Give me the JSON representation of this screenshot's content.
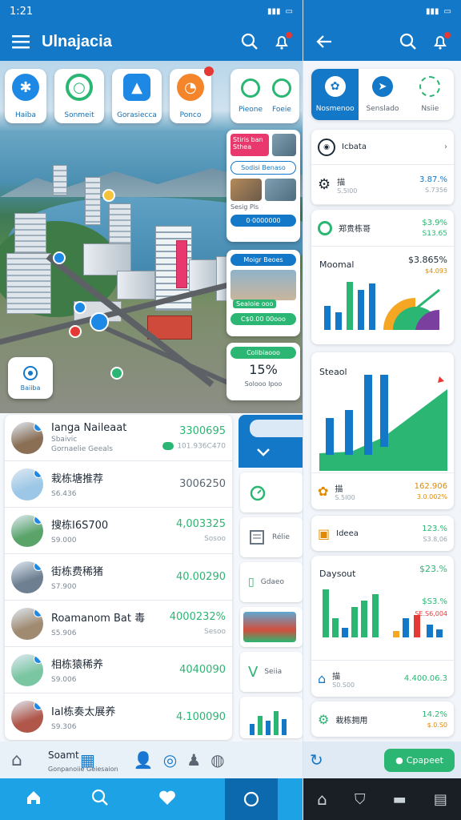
{
  "left": {
    "status": {
      "time": "1:21"
    },
    "header": {
      "title": "Ulnajacia"
    },
    "categories": [
      {
        "label": "Haiba",
        "icon": "asterisk-icon",
        "color": "#1e88e5"
      },
      {
        "label": "Sonmeit",
        "icon": "ring-icon",
        "color": "#2bb673"
      },
      {
        "label": "Gorasiecca",
        "icon": "cap-icon",
        "color": "#1e88e5"
      },
      {
        "label": "Ponco",
        "icon": "tag-icon",
        "color": "#f5852a"
      }
    ],
    "categories_right": [
      {
        "label": "Pieone"
      },
      {
        "label": "Foeie"
      }
    ],
    "side_cards": {
      "card1": {
        "pink_text": "Stiris ban Sthea",
        "pill": "Sodisi Benaso",
        "caption": "Sesig Pls",
        "button": "0·0000000"
      },
      "card2": {
        "pill": "Moigr Beoes",
        "tag": "Sealoie ooo",
        "button": "C$0.00 00ooo"
      },
      "card3": {
        "pill": "Colibiaooo",
        "percent": "15%",
        "caption": "Solooo Ipoo"
      }
    },
    "location_button": {
      "label": "Baiiba"
    },
    "list": [
      {
        "title": "Ianga Naileaat",
        "sub": "Sbaivic",
        "sub2": "Gornaelie Geeals",
        "value": "3300695",
        "value2": "101.936C470",
        "value_color": "#2bb673",
        "avatar": "#8a6f55"
      },
      {
        "title": "栽栋塘推荐",
        "sub": "S6.436",
        "value": "3006250",
        "value2": "",
        "value_color": "#5b6673",
        "avatar": "#9cc7e6"
      },
      {
        "title": "搜栋I6S700",
        "sub": "S9.000",
        "value": "4,003325",
        "value2": "Sosoo",
        "value_color": "#2bb673",
        "avatar": "#5aa46a"
      },
      {
        "title": "街栋费稀猪",
        "sub": "S7.900",
        "value": "40.00290",
        "value2": "",
        "value_color": "#2bb673",
        "avatar": "#6e7f91"
      },
      {
        "title": "Roamanom Bat 毒",
        "sub": "S5.906",
        "value": "4000232%",
        "value2": "Sesoo",
        "value_color": "#2bb673",
        "avatar": "#a08a70"
      },
      {
        "title": "相栋猿稀养",
        "sub": "S9.006",
        "value": "4040090",
        "value2": "",
        "value_color": "#2bb673",
        "avatar": "#7bc6a2"
      },
      {
        "title": "Ial栋奏太展养",
        "sub": "S9.306",
        "value": "4.100090",
        "value2": "",
        "value_color": "#2bb673",
        "avatar": "#b0574a"
      }
    ],
    "strip": {
      "tiles": [
        "",
        "Rélie",
        "Gdaeo",
        "",
        "Seiia"
      ]
    },
    "subnav": {
      "label": "Soamt",
      "sub": "Gonpanoiie Geiesaion"
    },
    "bottom_nav": [
      "home-icon",
      "search-icon",
      "heart-icon",
      "circle-icon"
    ]
  },
  "right": {
    "tabs": [
      {
        "label": "Nosmenoo"
      },
      {
        "label": "Senslado"
      },
      {
        "label": "Nsiie"
      }
    ],
    "location_row": {
      "label": "Icbata"
    },
    "rows": [
      {
        "title": "描",
        "sub": "S.5I00",
        "v1": "3.87.%",
        "v2": "S.7356",
        "v1_color": "#1478c8"
      },
      {
        "title": "郑贵栋哥",
        "sub": "",
        "v1": "$3.9%",
        "v2": "S13.65",
        "v1_color": "#2bb673"
      }
    ],
    "chart1": {
      "title": "Moomal",
      "value": "$3.865%",
      "value2": "$4.093"
    },
    "chart2": {
      "title": "Steaol"
    },
    "rows2": [
      {
        "title": "描",
        "sub": "S.5I00",
        "v1": "162.906",
        "v2": "3.0.002%",
        "v1_color": "#e08a00"
      },
      {
        "title": "Ideea",
        "sub": "",
        "v1": "123.%",
        "v2": "S3.8,06",
        "v1_color": "#2bb673"
      }
    ],
    "chart3": {
      "title": "Daysout",
      "value": "$23.%",
      "value2": "$S3.%",
      "value3": "SE.S6,004"
    },
    "rows3": [
      {
        "title": "描",
        "sub": "S0.S00",
        "v1": "4.400.06.3",
        "v2": "",
        "v1_color": "#2bb673"
      },
      {
        "title": "栽栋拥用",
        "sub": "",
        "v1": "14.2%",
        "v2": "$.0.S0",
        "v1_color": "#2bb673"
      }
    ],
    "cta": {
      "label": "Cpapeet"
    }
  },
  "colors": {
    "primary": "#1478c8",
    "green": "#2bb673",
    "orange": "#f5852a",
    "red": "#e53935"
  }
}
